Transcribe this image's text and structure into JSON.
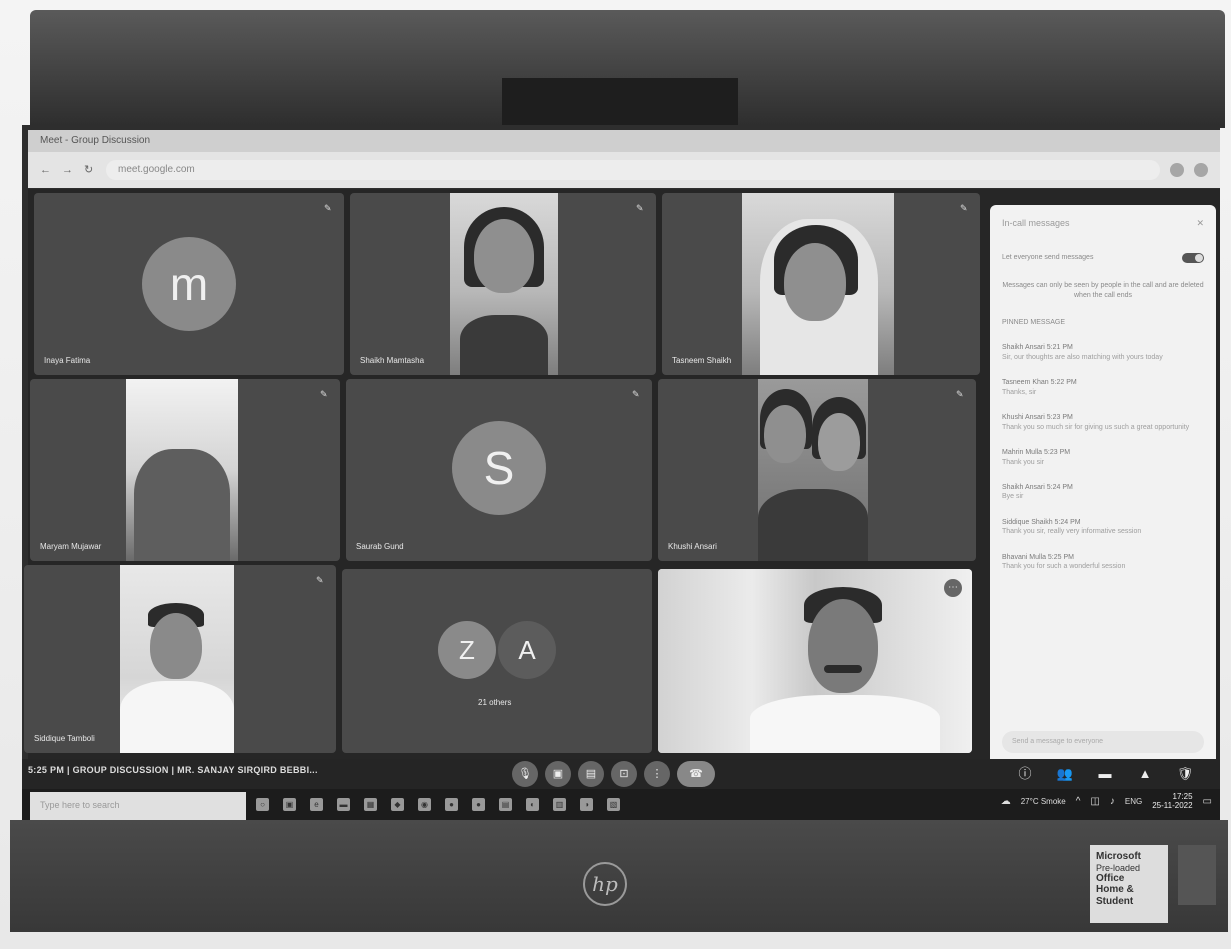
{
  "meeting": {
    "time_label": "5:25 PM",
    "separator": "|",
    "title": "GROUP DISCUSSION | MR. SANJAY SIRQIRD BEBBI...",
    "controls": [
      {
        "name": "mic-button",
        "icon": "mic-icon",
        "glyph": "🎙"
      },
      {
        "name": "camera-button",
        "icon": "camera-icon",
        "glyph": "▣"
      },
      {
        "name": "captions-button",
        "icon": "captions-icon",
        "glyph": "▤"
      },
      {
        "name": "present-button",
        "icon": "present-icon",
        "glyph": "⊡"
      },
      {
        "name": "more-options-button",
        "icon": "more-vert-icon",
        "glyph": "⋮"
      },
      {
        "name": "end-call-button",
        "icon": "end-call-icon",
        "glyph": "☎"
      }
    ],
    "right_controls": [
      {
        "name": "info-button",
        "icon": "info-icon",
        "glyph": "ⓘ"
      },
      {
        "name": "people-button",
        "icon": "people-icon",
        "glyph": "👥"
      },
      {
        "name": "chat-button",
        "icon": "chat-icon",
        "glyph": "▬"
      },
      {
        "name": "activities-button",
        "icon": "shapes-icon",
        "glyph": "▲"
      },
      {
        "name": "host-controls-button",
        "icon": "lock-icon",
        "glyph": "🛡"
      }
    ]
  },
  "participants": [
    {
      "id": "p1",
      "name": "Inaya Fatima",
      "avatar_letter": "m",
      "kind": "avatar"
    },
    {
      "id": "p2",
      "name": "Shaikh Mamtasha",
      "kind": "video"
    },
    {
      "id": "p3",
      "name": "Tasneem Shaikh",
      "kind": "video"
    },
    {
      "id": "p4",
      "name": "Maryam Mujawar",
      "kind": "video"
    },
    {
      "id": "p5",
      "name": "Saurab Gund",
      "avatar_letter": "S",
      "kind": "avatar"
    },
    {
      "id": "p6",
      "name": "Khushi Ansari",
      "kind": "video"
    },
    {
      "id": "p7",
      "name": "Siddique Tamboli",
      "kind": "video"
    },
    {
      "id": "p8",
      "name": "21 others",
      "avatar_letters": [
        "Z",
        "A"
      ],
      "kind": "group"
    },
    {
      "id": "p9",
      "name": "",
      "kind": "video"
    }
  ],
  "chat": {
    "title": "In-call messages",
    "toggle_label": "Let everyone send messages",
    "notice": "Messages can only be seen by people in the call and are deleted when the call ends",
    "pinned": "PINNED MESSAGE",
    "messages": [
      {
        "who": "Shaikh Ansari 5:21 PM",
        "text": "Sir, our thoughts are also matching with yours today"
      },
      {
        "who": "Tasneem Khan 5:22 PM",
        "text": "Thanks, sir"
      },
      {
        "who": "Khushi Ansari 5:23 PM",
        "text": "Thank you so much sir for giving us such a great opportunity"
      },
      {
        "who": "Mahrin Mulla 5:23 PM",
        "text": "Thank you sir"
      },
      {
        "who": "Shaikh Ansari 5:24 PM",
        "text": "Bye sir"
      },
      {
        "who": "Siddique Shaikh 5:24 PM",
        "text": "Thank you sir, really very informative session"
      },
      {
        "who": "Bhavani Mulla 5:25 PM",
        "text": "Thank you for such a wonderful session"
      }
    ],
    "input_placeholder": "Send a message to everyone"
  },
  "taskbar": {
    "search_placeholder": "Type here to search",
    "weather": "27°C Smoke",
    "lang": "ENG",
    "time": "17:25",
    "date": "25-11-2022"
  },
  "device": {
    "brand_logo": "hp",
    "sticker_brand": "Microsoft",
    "sticker_line1": "Pre-loaded",
    "sticker_line2": "Office",
    "sticker_line3": "Home & Student"
  },
  "browser": {
    "tab_title": "Meet - Group Discussion",
    "url": "meet.google.com"
  }
}
